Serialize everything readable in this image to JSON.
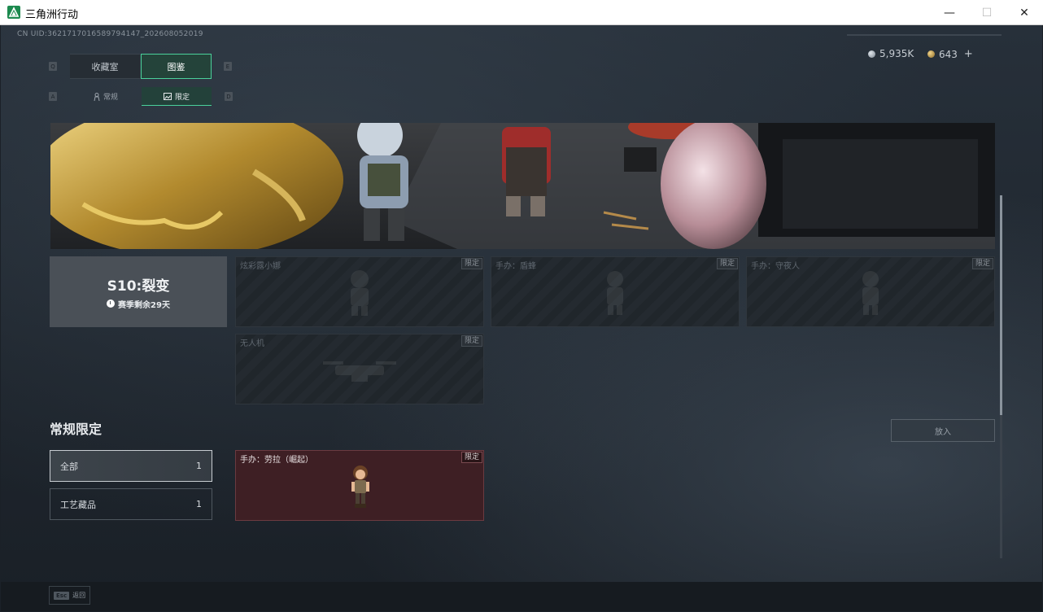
{
  "window": {
    "title": "三角洲行动",
    "minimize_glyph": "—",
    "maximize_glyph": "☐",
    "close_glyph": "✕"
  },
  "header": {
    "uid": "CN UID:3621717016589794147_202608052019",
    "currency_silver": "5,935K",
    "currency_gold": "643",
    "add_glyph": "+"
  },
  "tabs": [
    {
      "label": "收藏室",
      "key": "Q",
      "active": false
    },
    {
      "label": "图鉴",
      "key": "E",
      "active": true
    }
  ],
  "subtabs": [
    {
      "label": "常规",
      "key": "A",
      "active": false
    },
    {
      "label": "限定",
      "key": "D",
      "active": true
    }
  ],
  "season": {
    "title": "S10:裂变",
    "remaining": "赛季剩余29天"
  },
  "season_items": [
    {
      "name": "炫彩露小娜",
      "badge": "限定",
      "icon": "figure-icon"
    },
    {
      "name": "手办：盾蜂",
      "badge": "限定",
      "icon": "figure-icon"
    },
    {
      "name": "手办：守夜人",
      "badge": "限定",
      "icon": "figure-icon"
    },
    {
      "name": "无人机",
      "badge": "限定",
      "icon": "drone-icon"
    }
  ],
  "section": {
    "title": "常规限定"
  },
  "filters": [
    {
      "label": "全部",
      "count": "1",
      "active": true
    },
    {
      "label": "工艺藏品",
      "count": "1",
      "active": false
    }
  ],
  "owned_items": [
    {
      "name": "手办：劳拉（崛起）",
      "badge": "限定",
      "icon": "lara-figure-icon"
    }
  ],
  "actions": {
    "put_in": "放入",
    "esc_key": "Esc",
    "back": "返回"
  },
  "colors": {
    "accent": "#4ad19b",
    "owned_bg": "#3e1f24",
    "background": "#1b2128"
  }
}
